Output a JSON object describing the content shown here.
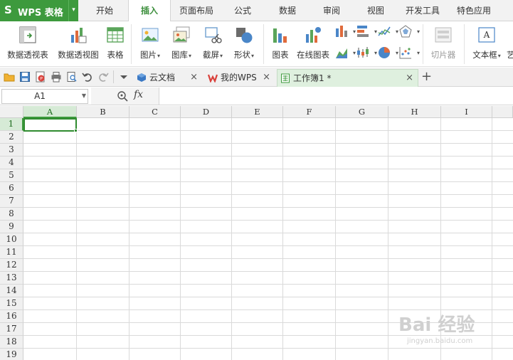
{
  "app": {
    "title": "WPS 表格",
    "logo": "S",
    "accent": "#3d9a3d"
  },
  "menu": {
    "tabs": [
      "开始",
      "插入",
      "页面布局",
      "公式",
      "数据",
      "审阅",
      "视图",
      "开发工具",
      "特色应用"
    ],
    "active_index": 1
  },
  "ribbon": {
    "pivot_table": "数据透视表",
    "pivot_chart": "数据透视图",
    "table": "表格",
    "picture": "图片",
    "gallery": "图库",
    "screenshot": "截屏",
    "shapes": "形状",
    "chart": "图表",
    "online_chart": "在线图表",
    "slicer": "切片器",
    "textbox": "文本框",
    "more": "艺"
  },
  "quick_access": {
    "icons": [
      "open-folder-icon",
      "save-icon",
      "pdf-export-icon",
      "print-icon",
      "print-preview-icon",
      "undo-icon",
      "redo-icon",
      "customize-dropdown-icon"
    ]
  },
  "doc_tabs": [
    {
      "label": "云文档",
      "icon": "cloud-doc-icon"
    },
    {
      "label": "我的WPS",
      "icon": "wps-logo-icon"
    },
    {
      "label": "工作簿1 *",
      "icon": "spreadsheet-icon"
    }
  ],
  "formula_bar": {
    "name_box": "A1",
    "fx_label": "fx",
    "formula_value": ""
  },
  "grid": {
    "columns": [
      "A",
      "B",
      "C",
      "D",
      "E",
      "F",
      "G",
      "H",
      "I"
    ],
    "rows": [
      "1",
      "2",
      "3",
      "4",
      "5",
      "6",
      "7",
      "8",
      "9",
      "10",
      "11",
      "12",
      "13",
      "14",
      "15",
      "16",
      "17",
      "18",
      "19"
    ],
    "active_cell": "A1"
  },
  "watermark": {
    "logo": "Bai 经验",
    "url": "jingyan.baidu.com"
  }
}
